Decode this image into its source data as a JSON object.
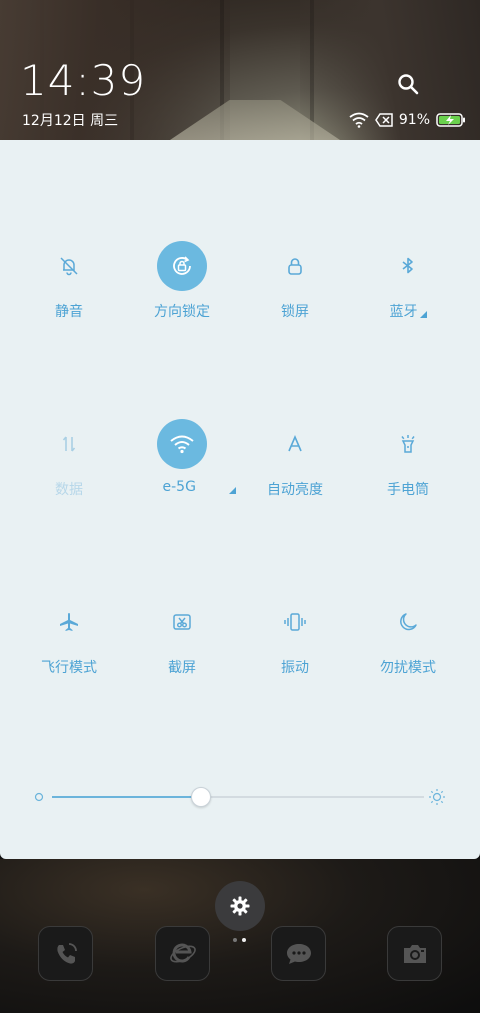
{
  "status": {
    "time": "14:39",
    "date": "12月12日 周三",
    "battery": "91%"
  },
  "tiles": [
    {
      "label": "静音",
      "icon": "bell-off-icon",
      "active": false
    },
    {
      "label": "方向锁定",
      "icon": "rotation-lock-icon",
      "active": true
    },
    {
      "label": "锁屏",
      "icon": "lock-icon",
      "active": false
    },
    {
      "label": "蓝牙",
      "icon": "bluetooth-icon",
      "active": false
    },
    {
      "label": "数据",
      "icon": "mobile-data-icon",
      "active": false
    },
    {
      "label": "e-5G",
      "icon": "wifi-icon",
      "active": true
    },
    {
      "label": "自动亮度",
      "icon": "auto-brightness-icon",
      "active": false
    },
    {
      "label": "手电筒",
      "icon": "flashlight-icon",
      "active": false
    },
    {
      "label": "飞行模式",
      "icon": "airplane-icon",
      "active": false
    },
    {
      "label": "截屏",
      "icon": "screenshot-icon",
      "active": false
    },
    {
      "label": "振动",
      "icon": "vibrate-icon",
      "active": false
    },
    {
      "label": "勿扰模式",
      "icon": "moon-icon",
      "active": false
    }
  ],
  "brightness": {
    "level": 0.4
  },
  "colors": {
    "accent": "#6bb9e0",
    "label": "#4da3d4",
    "panel": "#e9f1f3"
  },
  "dock": [
    {
      "icon": "phone-icon"
    },
    {
      "icon": "browser-icon"
    },
    {
      "icon": "message-icon"
    },
    {
      "icon": "camera-icon"
    }
  ]
}
